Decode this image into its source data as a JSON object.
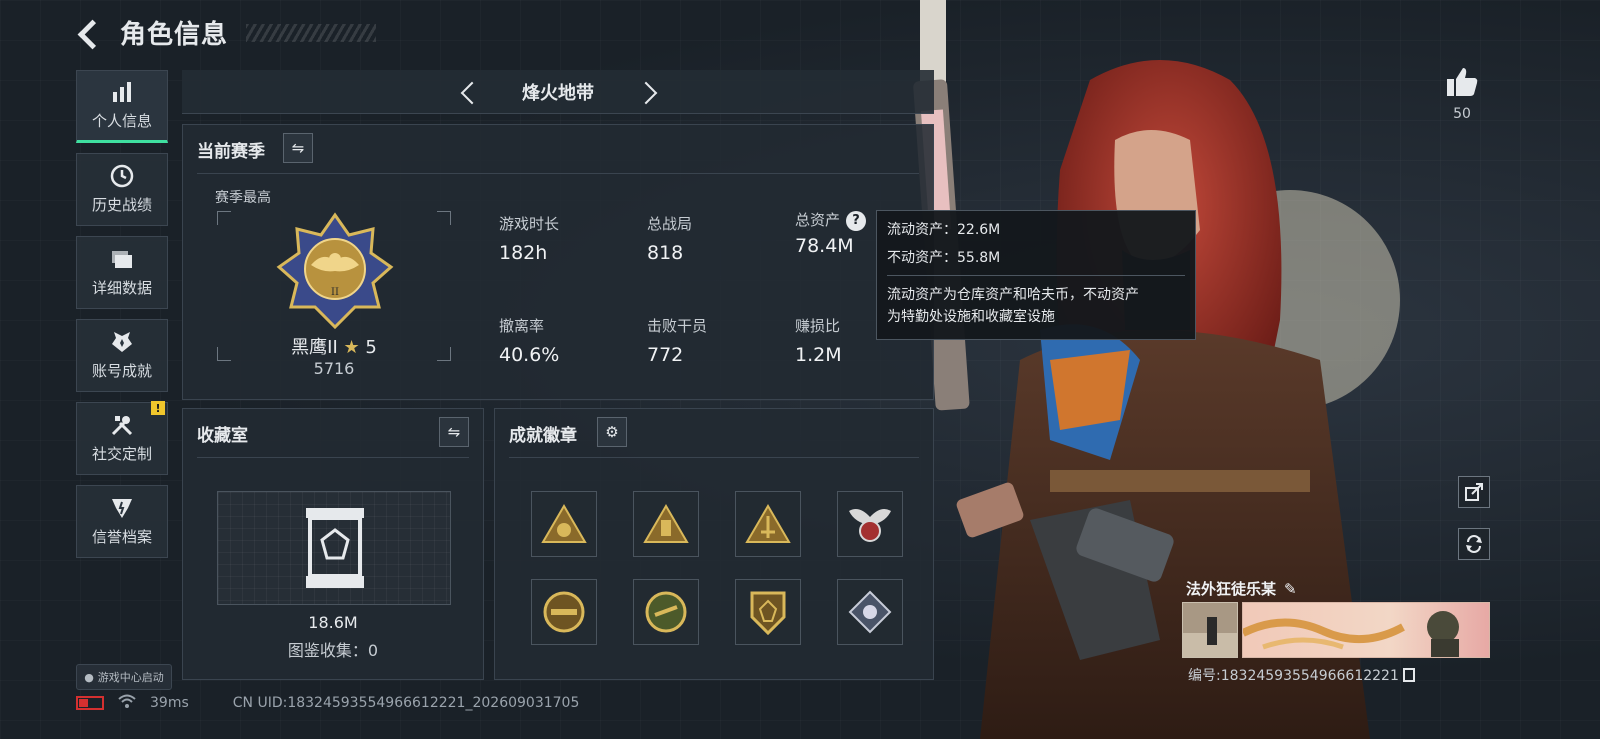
{
  "header": {
    "title": "角色信息"
  },
  "sidebar": {
    "items": [
      {
        "label": "个人信息",
        "icon": "bar-chart-icon",
        "active": true
      },
      {
        "label": "历史战绩",
        "icon": "clock-icon"
      },
      {
        "label": "详细数据",
        "icon": "folder-icon"
      },
      {
        "label": "账号成就",
        "icon": "achievement-icon"
      },
      {
        "label": "社交定制",
        "icon": "tools-icon",
        "badge": "!"
      },
      {
        "label": "信誉档案",
        "icon": "shield-icon"
      }
    ],
    "game_center": "游戏中心启动"
  },
  "mode": {
    "title": "烽火地带"
  },
  "season": {
    "title": "当前赛季",
    "best_label": "赛季最高",
    "rank_name": "黑鹰II",
    "rank_stars": "5",
    "rank_score": "5716",
    "stats": [
      {
        "label": "游戏时长",
        "value": "182h"
      },
      {
        "label": "总战局",
        "value": "818"
      },
      {
        "label": "总资产",
        "value": "78.4M",
        "help": "?"
      },
      {
        "label": "撤离率",
        "value": "40.6%"
      },
      {
        "label": "击败干员",
        "value": "772"
      },
      {
        "label": "赚损比",
        "value": "1.2M"
      }
    ]
  },
  "tooltip": {
    "liquid": "流动资产：22.6M",
    "fixed": "不动资产：55.8M",
    "desc_line1": "流动资产为仓库资产和哈夫币，不动资产",
    "desc_line2": "为特勤处设施和收藏室设施"
  },
  "collection": {
    "title": "收藏室",
    "value": "18.6M",
    "count": "图鉴收集：0"
  },
  "achievements": {
    "title": "成就徽章",
    "badges": [
      "triangle-badge-1",
      "triangle-badge-2",
      "triangle-badge-3",
      "winged-badge",
      "round-badge-1",
      "round-badge-2",
      "shield-badge",
      "diamond-badge"
    ]
  },
  "profile": {
    "likes": "50",
    "name": "法外狂徒乐某",
    "id": "编号:18324593554966612221"
  },
  "status": {
    "ping": "39ms",
    "uid": "CN UID:18324593554966612221_202609031705"
  },
  "colors": {
    "accent": "#3fe0a0",
    "gold": "#d9b85a",
    "alert": "#f0c62c"
  }
}
